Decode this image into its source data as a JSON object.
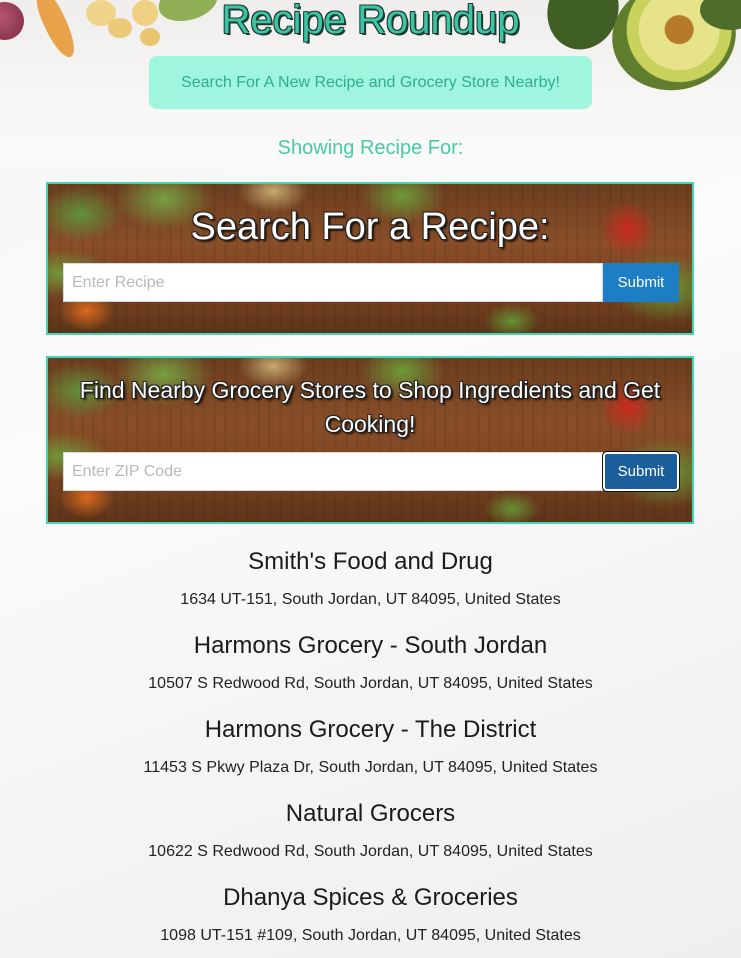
{
  "header": {
    "title": "Recipe Roundup",
    "tagline": "Search For A New Recipe and Grocery Store Nearby!",
    "showing_label": "Showing Recipe For:"
  },
  "recipe_search": {
    "title": "Search For a Recipe:",
    "placeholder": "Enter Recipe",
    "submit_label": "Submit"
  },
  "grocery_search": {
    "title": "Find Nearby Grocery Stores to Shop Ingredients and Get Cooking!",
    "placeholder": "Enter ZIP Code",
    "submit_label": "Submit"
  },
  "stores": [
    {
      "name": "Smith's Food and Drug",
      "address": "1634 UT-151, South Jordan, UT 84095, United States"
    },
    {
      "name": "Harmons Grocery - South Jordan",
      "address": "10507 S Redwood Rd, South Jordan, UT 84095, United States"
    },
    {
      "name": "Harmons Grocery - The District",
      "address": "11453 S Pkwy Plaza Dr, South Jordan, UT 84095, United States"
    },
    {
      "name": "Natural Grocers",
      "address": "10622 S Redwood Rd, South Jordan, UT 84095, United States"
    },
    {
      "name": "Dhanya Spices & Groceries",
      "address": "1098 UT-151 #109, South Jordan, UT 84095, United States"
    }
  ],
  "colors": {
    "accent": "#3cc4a4",
    "tagline_bg": "#9ff5dd",
    "panel_border": "#3fd6b5",
    "submit_bg": "#1e7ec4"
  }
}
